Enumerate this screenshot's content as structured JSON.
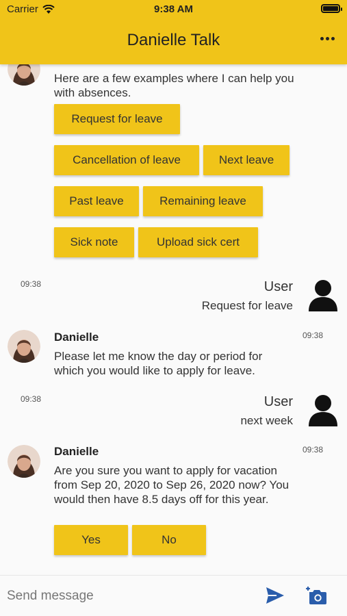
{
  "status_bar": {
    "carrier": "Carrier",
    "time": "9:38 AM"
  },
  "header": {
    "title": "Danielle Talk",
    "menu_icon": "more-horizontal-icon"
  },
  "messages": {
    "intro": {
      "text": "Here are a few examples where I can help you with absences.",
      "options": [
        "Request for leave",
        "Cancellation of leave",
        "Next leave",
        "Past leave",
        "Remaining leave",
        "Sick note",
        "Upload sick cert"
      ]
    },
    "user1": {
      "time": "09:38",
      "name": "User",
      "text": "Request for leave"
    },
    "bot2": {
      "name": "Danielle",
      "time": "09:38",
      "text": "Please let me know the day or period for which you would like to apply for leave."
    },
    "user2": {
      "time": "09:38",
      "name": "User",
      "text": "next week"
    },
    "bot3": {
      "name": "Danielle",
      "time": "09:38",
      "text": "Are you sure you want to apply for vacation from Sep 20, 2020 to Sep 26, 2020 now? You would then have 8.5 days off for this year.",
      "options": [
        "Yes",
        "No"
      ]
    }
  },
  "composer": {
    "placeholder": "Send message",
    "send_icon": "send-icon",
    "camera_icon": "add-photo-icon"
  },
  "colors": {
    "accent": "#f0c419",
    "background": "#fafafa",
    "text": "#333333"
  }
}
